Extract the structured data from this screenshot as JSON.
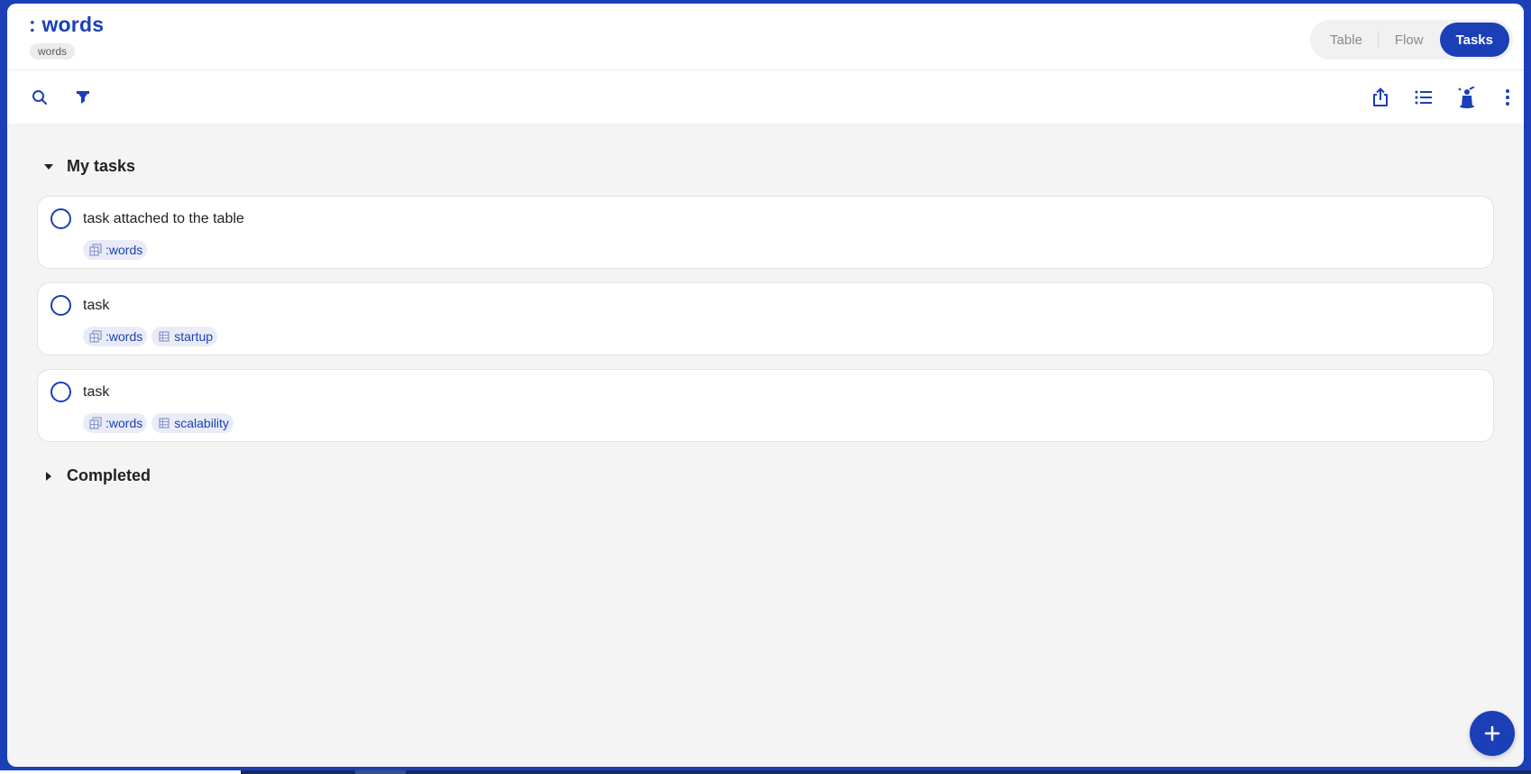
{
  "header": {
    "title": ": words",
    "subtitle": "words",
    "views": [
      {
        "label": "Table",
        "active": false
      },
      {
        "label": "Flow",
        "active": false
      },
      {
        "label": "Tasks",
        "active": true
      }
    ]
  },
  "toolbar": {
    "left_icons": [
      "search-icon",
      "filter-icon"
    ],
    "right_icons": [
      "share-icon",
      "list-icon",
      "magic-hat-icon",
      "more-vertical-icon"
    ]
  },
  "sections": {
    "my_tasks": {
      "label": "My tasks",
      "expanded": true
    },
    "completed": {
      "label": "Completed",
      "expanded": false
    }
  },
  "tasks": [
    {
      "title": "task attached to the table",
      "chips": [
        {
          "icon": "database-icon",
          "label": ":words"
        }
      ]
    },
    {
      "title": "task",
      "chips": [
        {
          "icon": "database-icon",
          "label": ":words"
        },
        {
          "icon": "table-icon",
          "label": "startup"
        }
      ]
    },
    {
      "title": "task",
      "chips": [
        {
          "icon": "database-icon",
          "label": ":words"
        },
        {
          "icon": "table-icon",
          "label": "scalability"
        }
      ]
    }
  ],
  "fab": {
    "icon": "plus-icon"
  },
  "colors": {
    "accent": "#1a3fb7",
    "background": "#f4f4f4",
    "card": "#ffffff",
    "chip": "#e9ecf6"
  }
}
